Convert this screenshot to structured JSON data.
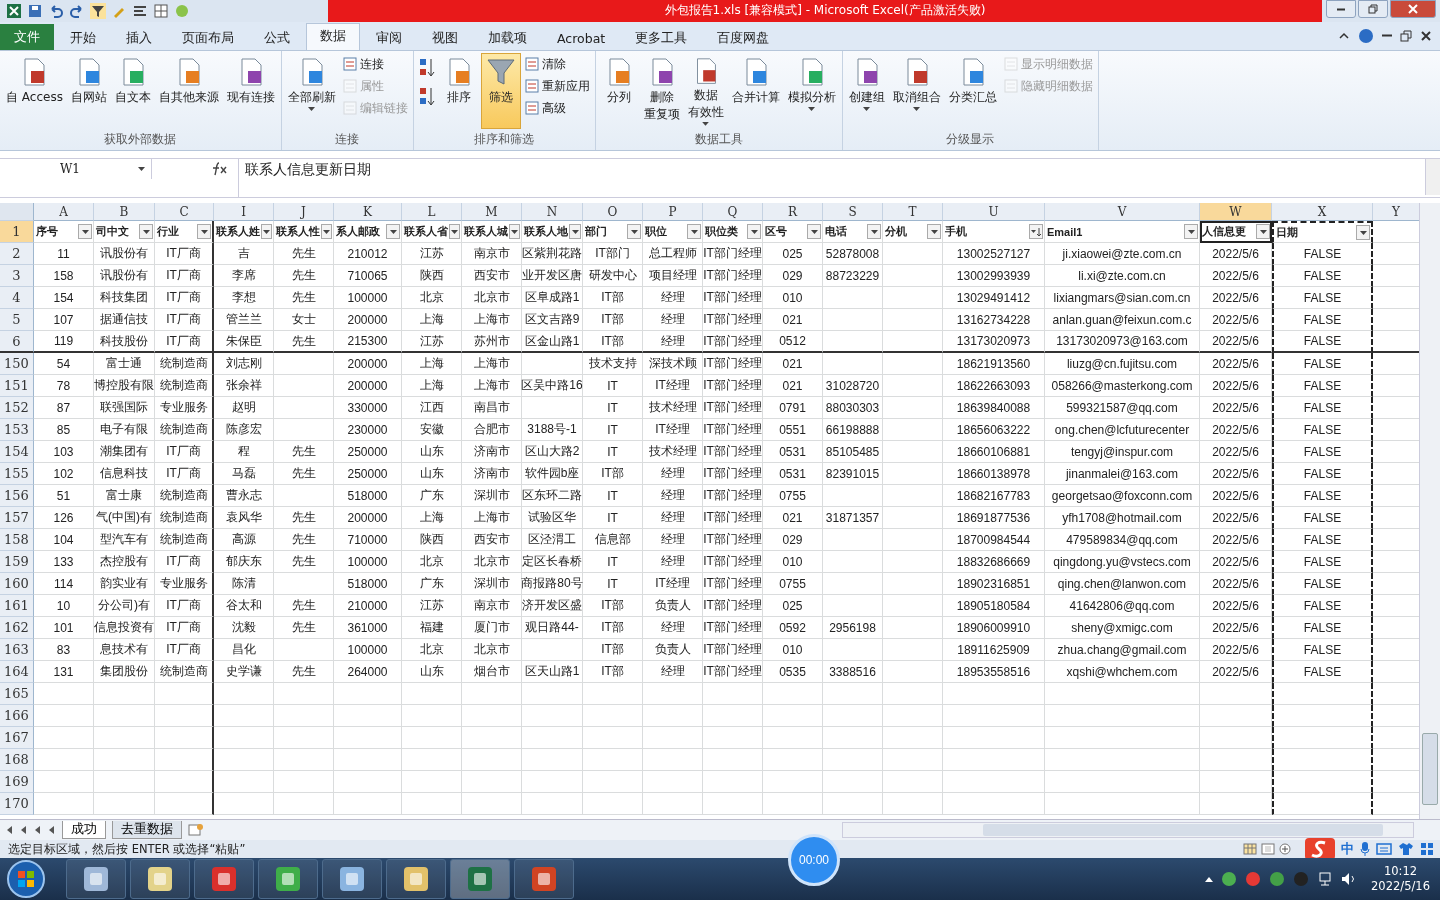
{
  "window": {
    "title": "外包报告1.xls  [兼容模式]  -  Microsoft Excel(产品激活失败)"
  },
  "ribbon_tabs": [
    {
      "label": "文件",
      "selected": false,
      "kind": "file"
    },
    {
      "label": "开始",
      "selected": false,
      "kind": "tab"
    },
    {
      "label": "插入",
      "selected": false,
      "kind": "tab"
    },
    {
      "label": "页面布局",
      "selected": false,
      "kind": "tab"
    },
    {
      "label": "公式",
      "selected": false,
      "kind": "tab"
    },
    {
      "label": "数据",
      "selected": true,
      "kind": "tab"
    },
    {
      "label": "审阅",
      "selected": false,
      "kind": "tab"
    },
    {
      "label": "视图",
      "selected": false,
      "kind": "tab"
    },
    {
      "label": "加载项",
      "selected": false,
      "kind": "tab"
    },
    {
      "label": "Acrobat",
      "selected": false,
      "kind": "tab"
    },
    {
      "label": "更多工具",
      "selected": false,
      "kind": "tab"
    },
    {
      "label": "百度网盘",
      "selected": false,
      "kind": "tab"
    }
  ],
  "ribbon_groups": [
    {
      "label": "获取外部数据",
      "items": [
        {
          "kind": "large",
          "label": "自 Access",
          "menu": false,
          "disabled": false,
          "on": false
        },
        {
          "kind": "large",
          "label": "自网站",
          "menu": false,
          "disabled": false,
          "on": false
        },
        {
          "kind": "large",
          "label": "自文本",
          "menu": false,
          "disabled": false,
          "on": false
        },
        {
          "kind": "large",
          "label": "自其他来源",
          "menu": false,
          "disabled": false,
          "on": false
        },
        {
          "kind": "large",
          "label": "现有连接",
          "menu": false,
          "disabled": false,
          "on": false
        }
      ]
    },
    {
      "label": "连接",
      "items": [
        {
          "kind": "large",
          "label": "全部刷新",
          "menu": true,
          "disabled": false,
          "on": false
        },
        {
          "kind": "small",
          "label": "连接",
          "menu": false,
          "disabled": false,
          "on": false
        },
        {
          "kind": "small",
          "label": "属性",
          "menu": false,
          "disabled": true,
          "on": false
        },
        {
          "kind": "small",
          "label": "编辑链接",
          "menu": false,
          "disabled": true,
          "on": false
        }
      ]
    },
    {
      "label": "排序和筛选",
      "items": [
        {
          "kind": "sort_asc",
          "menu": false,
          "disabled": false,
          "on": false
        },
        {
          "kind": "sort_desc",
          "menu": false,
          "disabled": false,
          "on": false
        },
        {
          "kind": "large",
          "label": "排序",
          "menu": false,
          "disabled": false,
          "on": false
        },
        {
          "kind": "funnel",
          "label": "筛选",
          "menu": false,
          "disabled": false,
          "on": true
        },
        {
          "kind": "small",
          "label": "清除",
          "menu": false,
          "disabled": false,
          "on": false
        },
        {
          "kind": "small",
          "label": "重新应用",
          "menu": false,
          "disabled": false,
          "on": false
        },
        {
          "kind": "small",
          "label": "高级",
          "menu": false,
          "disabled": false,
          "on": false
        }
      ]
    },
    {
      "label": "数据工具",
      "items": [
        {
          "kind": "large",
          "label": "分列",
          "menu": false,
          "disabled": false,
          "on": false
        },
        {
          "kind": "large",
          "label": "删除",
          "label_2": "重复项",
          "menu": false,
          "disabled": false,
          "on": false
        },
        {
          "kind": "large",
          "label": "数据",
          "label_2": "有效性",
          "menu": true,
          "disabled": false,
          "on": false
        },
        {
          "kind": "large",
          "label": "合并计算",
          "menu": false,
          "disabled": false,
          "on": false
        },
        {
          "kind": "large",
          "label": "模拟分析",
          "menu": true,
          "disabled": false,
          "on": false
        }
      ]
    },
    {
      "label": "分级显示",
      "items": [
        {
          "kind": "large",
          "label": "创建组",
          "menu": true,
          "disabled": false,
          "on": false
        },
        {
          "kind": "large",
          "label": "取消组合",
          "menu": true,
          "disabled": false,
          "on": false
        },
        {
          "kind": "large",
          "label": "分类汇总",
          "menu": false,
          "disabled": false,
          "on": false
        },
        {
          "kind": "small",
          "label": "显示明细数据",
          "menu": false,
          "disabled": true,
          "on": false
        },
        {
          "kind": "small",
          "label": "隐藏明细数据",
          "menu": false,
          "disabled": true,
          "on": false
        }
      ]
    }
  ],
  "formula_bar": {
    "name_box": "W1",
    "formula": "联系人信息更新日期"
  },
  "sheet": {
    "header_row": "1",
    "header_row_selected": true,
    "columns": [
      {
        "letter": "A",
        "header": "序号",
        "filter": true,
        "sorted": false,
        "selected": false,
        "marquee": false
      },
      {
        "letter": "B",
        "header": "司中文",
        "filter": true,
        "sorted": false,
        "selected": false,
        "marquee": false
      },
      {
        "letter": "C",
        "header": "行业",
        "filter": true,
        "sorted": false,
        "selected": false,
        "marquee": false
      },
      {
        "letter": "I",
        "header": "联系人姓",
        "filter": true,
        "sorted": false,
        "selected": false,
        "marquee": false
      },
      {
        "letter": "J",
        "header": "联系人性",
        "filter": true,
        "sorted": false,
        "selected": false,
        "marquee": false
      },
      {
        "letter": "K",
        "header": "系人邮政",
        "filter": true,
        "sorted": false,
        "selected": false,
        "marquee": false
      },
      {
        "letter": "L",
        "header": "联系人省",
        "filter": true,
        "sorted": false,
        "selected": false,
        "marquee": false
      },
      {
        "letter": "M",
        "header": "联系人城",
        "filter": true,
        "sorted": false,
        "selected": false,
        "marquee": false
      },
      {
        "letter": "N",
        "header": "联系人地",
        "filter": true,
        "sorted": false,
        "selected": false,
        "marquee": false
      },
      {
        "letter": "O",
        "header": "部门",
        "filter": true,
        "sorted": false,
        "selected": false,
        "marquee": false
      },
      {
        "letter": "P",
        "header": "职位",
        "filter": true,
        "sorted": false,
        "selected": false,
        "marquee": false
      },
      {
        "letter": "Q",
        "header": "职位类",
        "filter": true,
        "sorted": false,
        "selected": false,
        "marquee": false
      },
      {
        "letter": "R",
        "header": "区号",
        "filter": true,
        "sorted": false,
        "selected": false,
        "marquee": false
      },
      {
        "letter": "S",
        "header": "电话",
        "filter": true,
        "sorted": false,
        "selected": false,
        "marquee": false
      },
      {
        "letter": "T",
        "header": "分机",
        "filter": true,
        "sorted": false,
        "selected": false,
        "marquee": false
      },
      {
        "letter": "U",
        "header": "手机",
        "filter": true,
        "sorted": true,
        "selected": false,
        "marquee": false
      },
      {
        "letter": "V",
        "header": "Email1",
        "filter": true,
        "sorted": false,
        "selected": false,
        "marquee": false
      },
      {
        "letter": "W",
        "header": "人信息更",
        "filter": true,
        "sorted": false,
        "selected": true,
        "marquee": false
      },
      {
        "letter": "X",
        "header": "日期",
        "filter": true,
        "sorted": false,
        "selected": false,
        "marquee": true
      },
      {
        "letter": "Y",
        "filter": false,
        "sorted": false,
        "selected": false,
        "marquee": false
      }
    ],
    "rows": [
      {
        "number": "2",
        "cells": [
          "11",
          "讯股份有",
          "IT厂商",
          "吉",
          "先生",
          "210012",
          "江苏",
          "南京市",
          "区紫荆花路",
          "IT部门",
          "总工程师",
          "IT部门经理",
          "025",
          "52878008",
          null,
          "13002527127",
          "ji.xiaowei@zte.com.cn",
          "2022/5/6",
          "FALSE"
        ]
      },
      {
        "number": "3",
        "cells": [
          "158",
          "讯股份有",
          "IT厂商",
          "李席",
          "先生",
          "710065",
          "陕西",
          "西安市",
          "业开发区唐",
          "研发中心",
          "项目经理",
          "IT部门经理",
          "029",
          "88723229",
          null,
          "13002993939",
          "li.xi@zte.com.cn",
          "2022/5/6",
          "FALSE"
        ]
      },
      {
        "number": "4",
        "cells": [
          "154",
          "科技集团",
          "IT厂商",
          "李想",
          "先生",
          "100000",
          "北京",
          "北京市",
          "区阜成路1",
          "IT部",
          "经理",
          "IT部门经理",
          "010",
          null,
          null,
          "13029491412",
          "lixiangmars@sian.com.cn",
          "2022/5/6",
          "FALSE"
        ]
      },
      {
        "number": "5",
        "cells": [
          "107",
          "据通信技",
          "IT厂商",
          "管兰兰",
          "女士",
          "200000",
          "上海",
          "上海市",
          "区文吉路9",
          "IT部",
          "经理",
          "IT部门经理",
          "021",
          null,
          null,
          "13162734228",
          "anlan.guan@feixun.com.c",
          "2022/5/6",
          "FALSE"
        ]
      },
      {
        "number": "6",
        "cells": [
          "119",
          "科技股份",
          "IT厂商",
          "朱保臣",
          "先生",
          "215300",
          "江苏",
          "苏州市",
          "区金山路1",
          "IT部",
          "经理",
          "IT部门经理",
          "0512",
          null,
          null,
          "13173020973",
          "13173020973@163.com",
          "2022/5/6",
          "FALSE"
        ]
      },
      {
        "number": "150",
        "cells": [
          "54",
          "富士通",
          "统制造商",
          "刘志刚",
          null,
          "200000",
          "上海",
          "上海市",
          null,
          "技术支持",
          "深技术顾",
          "IT部门经理",
          "021",
          null,
          null,
          "18621913560",
          "liuzg@cn.fujitsu.com",
          "2022/5/6",
          "FALSE"
        ]
      },
      {
        "number": "151",
        "cells": [
          "78",
          "博控股有限",
          "统制造商",
          "张余祥",
          null,
          "200000",
          "上海",
          "上海市",
          "区吴中路16",
          "IT",
          "IT经理",
          "IT部门经理",
          "021",
          "31028720",
          null,
          "18622663093",
          "058266@masterkong.com",
          "2022/5/6",
          "FALSE"
        ]
      },
      {
        "number": "152",
        "cells": [
          "87",
          "联强国际",
          "专业服务",
          "赵明",
          null,
          "330000",
          "江西",
          "南昌市",
          null,
          "IT",
          "技术经理",
          "IT部门经理",
          "0791",
          "88030303",
          null,
          "18639840088",
          "599321587@qq.com",
          "2022/5/6",
          "FALSE"
        ]
      },
      {
        "number": "153",
        "cells": [
          "85",
          "电子有限",
          "统制造商",
          "陈彦宏",
          null,
          "230000",
          "安徽",
          "合肥市",
          "3188号-1",
          "IT",
          "IT经理",
          "IT部门经理",
          "0551",
          "66198888",
          null,
          "18656063222",
          "ong.chen@lcfuturecenter",
          "2022/5/6",
          "FALSE"
        ]
      },
      {
        "number": "154",
        "cells": [
          "103",
          "潮集团有",
          "IT厂商",
          "程",
          "先生",
          "250000",
          "山东",
          "济南市",
          "区山大路2",
          "IT",
          "技术经理",
          "IT部门经理",
          "0531",
          "85105485",
          null,
          "18660106881",
          "tengyj@inspur.com",
          "2022/5/6",
          "FALSE"
        ]
      },
      {
        "number": "155",
        "cells": [
          "102",
          "信息科技",
          "IT厂商",
          "马磊",
          "先生",
          "250000",
          "山东",
          "济南市",
          "软件园b座",
          "IT部",
          "经理",
          "IT部门经理",
          "0531",
          "82391015",
          null,
          "18660138978",
          "jinanmalei@163.com",
          "2022/5/6",
          "FALSE"
        ]
      },
      {
        "number": "156",
        "cells": [
          "51",
          "富士康",
          "统制造商",
          "曹永志",
          null,
          "518000",
          "广东",
          "深圳市",
          "区东环二路",
          "IT",
          "经理",
          "IT部门经理",
          "0755",
          null,
          null,
          "18682167783",
          "georgetsao@foxconn.com",
          "2022/5/6",
          "FALSE"
        ]
      },
      {
        "number": "157",
        "cells": [
          "126",
          "气(中国)有",
          "统制造商",
          "袁风华",
          "先生",
          "200000",
          "上海",
          "上海市",
          "试验区华",
          "IT",
          "经理",
          "IT部门经理",
          "021",
          "31871357",
          null,
          "18691877536",
          "yfh1708@hotmail.com",
          "2022/5/6",
          "FALSE"
        ]
      },
      {
        "number": "158",
        "cells": [
          "104",
          "型汽车有",
          "统制造商",
          "高源",
          "先生",
          "710000",
          "陕西",
          "西安市",
          "区泾渭工",
          "信息部",
          "经理",
          "IT部门经理",
          "029",
          null,
          null,
          "18700984544",
          "479589834@qq.com",
          "2022/5/6",
          "FALSE"
        ]
      },
      {
        "number": "159",
        "cells": [
          "133",
          "杰控股有",
          "IT厂商",
          "郁庆东",
          "先生",
          "100000",
          "北京",
          "北京市",
          "定区长春桥",
          "IT",
          "经理",
          "IT部门经理",
          "010",
          null,
          null,
          "18832686669",
          "qingdong.yu@vstecs.com",
          "2022/5/6",
          "FALSE"
        ]
      },
      {
        "number": "160",
        "cells": [
          "114",
          "韵实业有",
          "专业服务",
          "陈清",
          null,
          "518000",
          "广东",
          "深圳市",
          "商报路80号",
          "IT",
          "IT经理",
          "IT部门经理",
          "0755",
          null,
          null,
          "18902316851",
          "qing.chen@lanwon.com",
          "2022/5/6",
          "FALSE"
        ]
      },
      {
        "number": "161",
        "cells": [
          "10",
          "分公司)有",
          "IT厂商",
          "谷太和",
          "先生",
          "210000",
          "江苏",
          "南京市",
          "济开发区盛",
          "IT部",
          "负责人",
          "IT部门经理",
          "025",
          null,
          null,
          "18905180584",
          "41642806@qq.com",
          "2022/5/6",
          "FALSE"
        ]
      },
      {
        "number": "162",
        "cells": [
          "101",
          "信息投资有",
          "IT厂商",
          "沈毅",
          "先生",
          "361000",
          "福建",
          "厦门市",
          "观日路44-",
          "IT部",
          "经理",
          "IT部门经理",
          "0592",
          "2956198",
          null,
          "18906009910",
          "sheny@xmigc.com",
          "2022/5/6",
          "FALSE"
        ]
      },
      {
        "number": "163",
        "cells": [
          "83",
          "息技术有",
          "IT厂商",
          "昌化",
          null,
          "100000",
          "北京",
          "北京市",
          null,
          "IT部",
          "负责人",
          "IT部门经理",
          "010",
          null,
          null,
          "18911625909",
          "zhua.chang@gmail.com",
          "2022/5/6",
          "FALSE"
        ]
      },
      {
        "number": "164",
        "cells": [
          "131",
          "集团股份",
          "统制造商",
          "史学谦",
          "先生",
          "264000",
          "山东",
          "烟台市",
          "区天山路1",
          "IT部",
          "经理",
          "IT部门经理",
          "0535",
          "3388516",
          null,
          "18953558516",
          "xqshi@whchem.com",
          "2022/5/6",
          "FALSE"
        ]
      },
      {
        "number": "165"
      },
      {
        "number": "166"
      },
      {
        "number": "167"
      },
      {
        "number": "168"
      },
      {
        "number": "169"
      },
      {
        "number": "170"
      }
    ]
  },
  "sheet_tabs": [
    {
      "label": "成功",
      "selected": true
    },
    {
      "label": "去重数据",
      "selected": false
    }
  ],
  "status_bar": {
    "message": "选定目标区域，然后按 ENTER 或选择“粘贴”"
  },
  "recorder": {
    "time": "00:00"
  },
  "taskbar": {
    "ime": "中",
    "time": "10:12",
    "date": "2022/5/16"
  }
}
